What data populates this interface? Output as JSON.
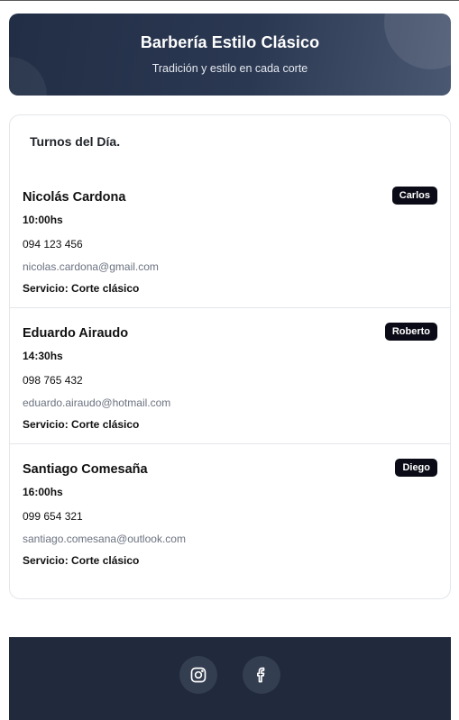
{
  "header": {
    "title": "Barbería Estilo Clásico",
    "subtitle": "Tradición y estilo en cada corte"
  },
  "appointments_card": {
    "title": "Turnos del Día.",
    "items": [
      {
        "client": "Nicolás Cardona",
        "barber": "Carlos",
        "time": "10:00hs",
        "phone": "094 123 456",
        "email": "nicolas.cardona@gmail.com",
        "service": "Servicio: Corte clásico"
      },
      {
        "client": "Eduardo Airaudo",
        "barber": "Roberto",
        "time": "14:30hs",
        "phone": "098 765 432",
        "email": "eduardo.airaudo@hotmail.com",
        "service": "Servicio: Corte clásico"
      },
      {
        "client": "Santiago Comesaña",
        "barber": "Diego",
        "time": "16:00hs",
        "phone": "099 654 321",
        "email": "santiago.comesana@outlook.com",
        "service": "Servicio: Corte clásico"
      }
    ]
  },
  "footer": {
    "social_icons": [
      "instagram-icon",
      "facebook-icon"
    ]
  },
  "colors": {
    "header_gradient_start": "#222e45",
    "header_gradient_end": "#4a5872",
    "badge_bg": "#0b0b17",
    "footer_bg": "#202a3c",
    "social_button_bg": "#343e51"
  }
}
